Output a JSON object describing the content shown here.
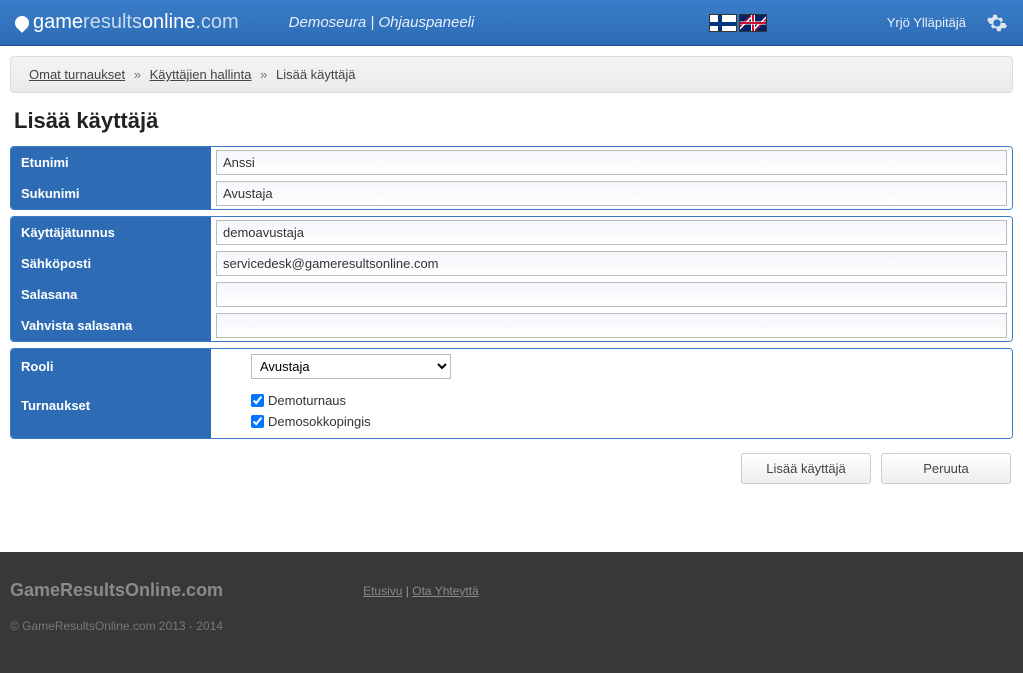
{
  "header": {
    "logo_prefix": "game",
    "logo_mid": "results",
    "logo_suffix": "online",
    "logo_tld": ".com",
    "subtitle": "Demoseura | Ohjauspaneeli",
    "user": "Yrjö Ylläpitäjä"
  },
  "breadcrumb": {
    "items": [
      "Omat turnaukset",
      "Käyttäjien hallinta",
      "Lisää käyttäjä"
    ]
  },
  "page": {
    "title": "Lisää käyttäjä"
  },
  "form": {
    "firstname": {
      "label": "Etunimi",
      "value": "Anssi"
    },
    "lastname": {
      "label": "Sukunimi",
      "value": "Avustaja"
    },
    "username": {
      "label": "Käyttäjätunnus",
      "value": "demoavustaja"
    },
    "email": {
      "label": "Sähköposti",
      "value": "servicedesk@gameresultsonline.com"
    },
    "password": {
      "label": "Salasana",
      "value": ""
    },
    "password2": {
      "label": "Vahvista salasana",
      "value": ""
    },
    "role": {
      "label": "Rooli",
      "value": "Avustaja"
    },
    "tournaments": {
      "label": "Turnaukset",
      "options": [
        {
          "label": "Demoturnaus",
          "checked": true
        },
        {
          "label": "Demosokkopingis",
          "checked": true
        }
      ]
    }
  },
  "buttons": {
    "submit": "Lisää käyttäjä",
    "cancel": "Peruuta"
  },
  "footer": {
    "title": "GameResultsOnline.com",
    "links": [
      "Etusivu",
      "Ota Yhteyttä"
    ],
    "sep": " | ",
    "copy": "© GameResultsOnline.com 2013 - 2014"
  }
}
